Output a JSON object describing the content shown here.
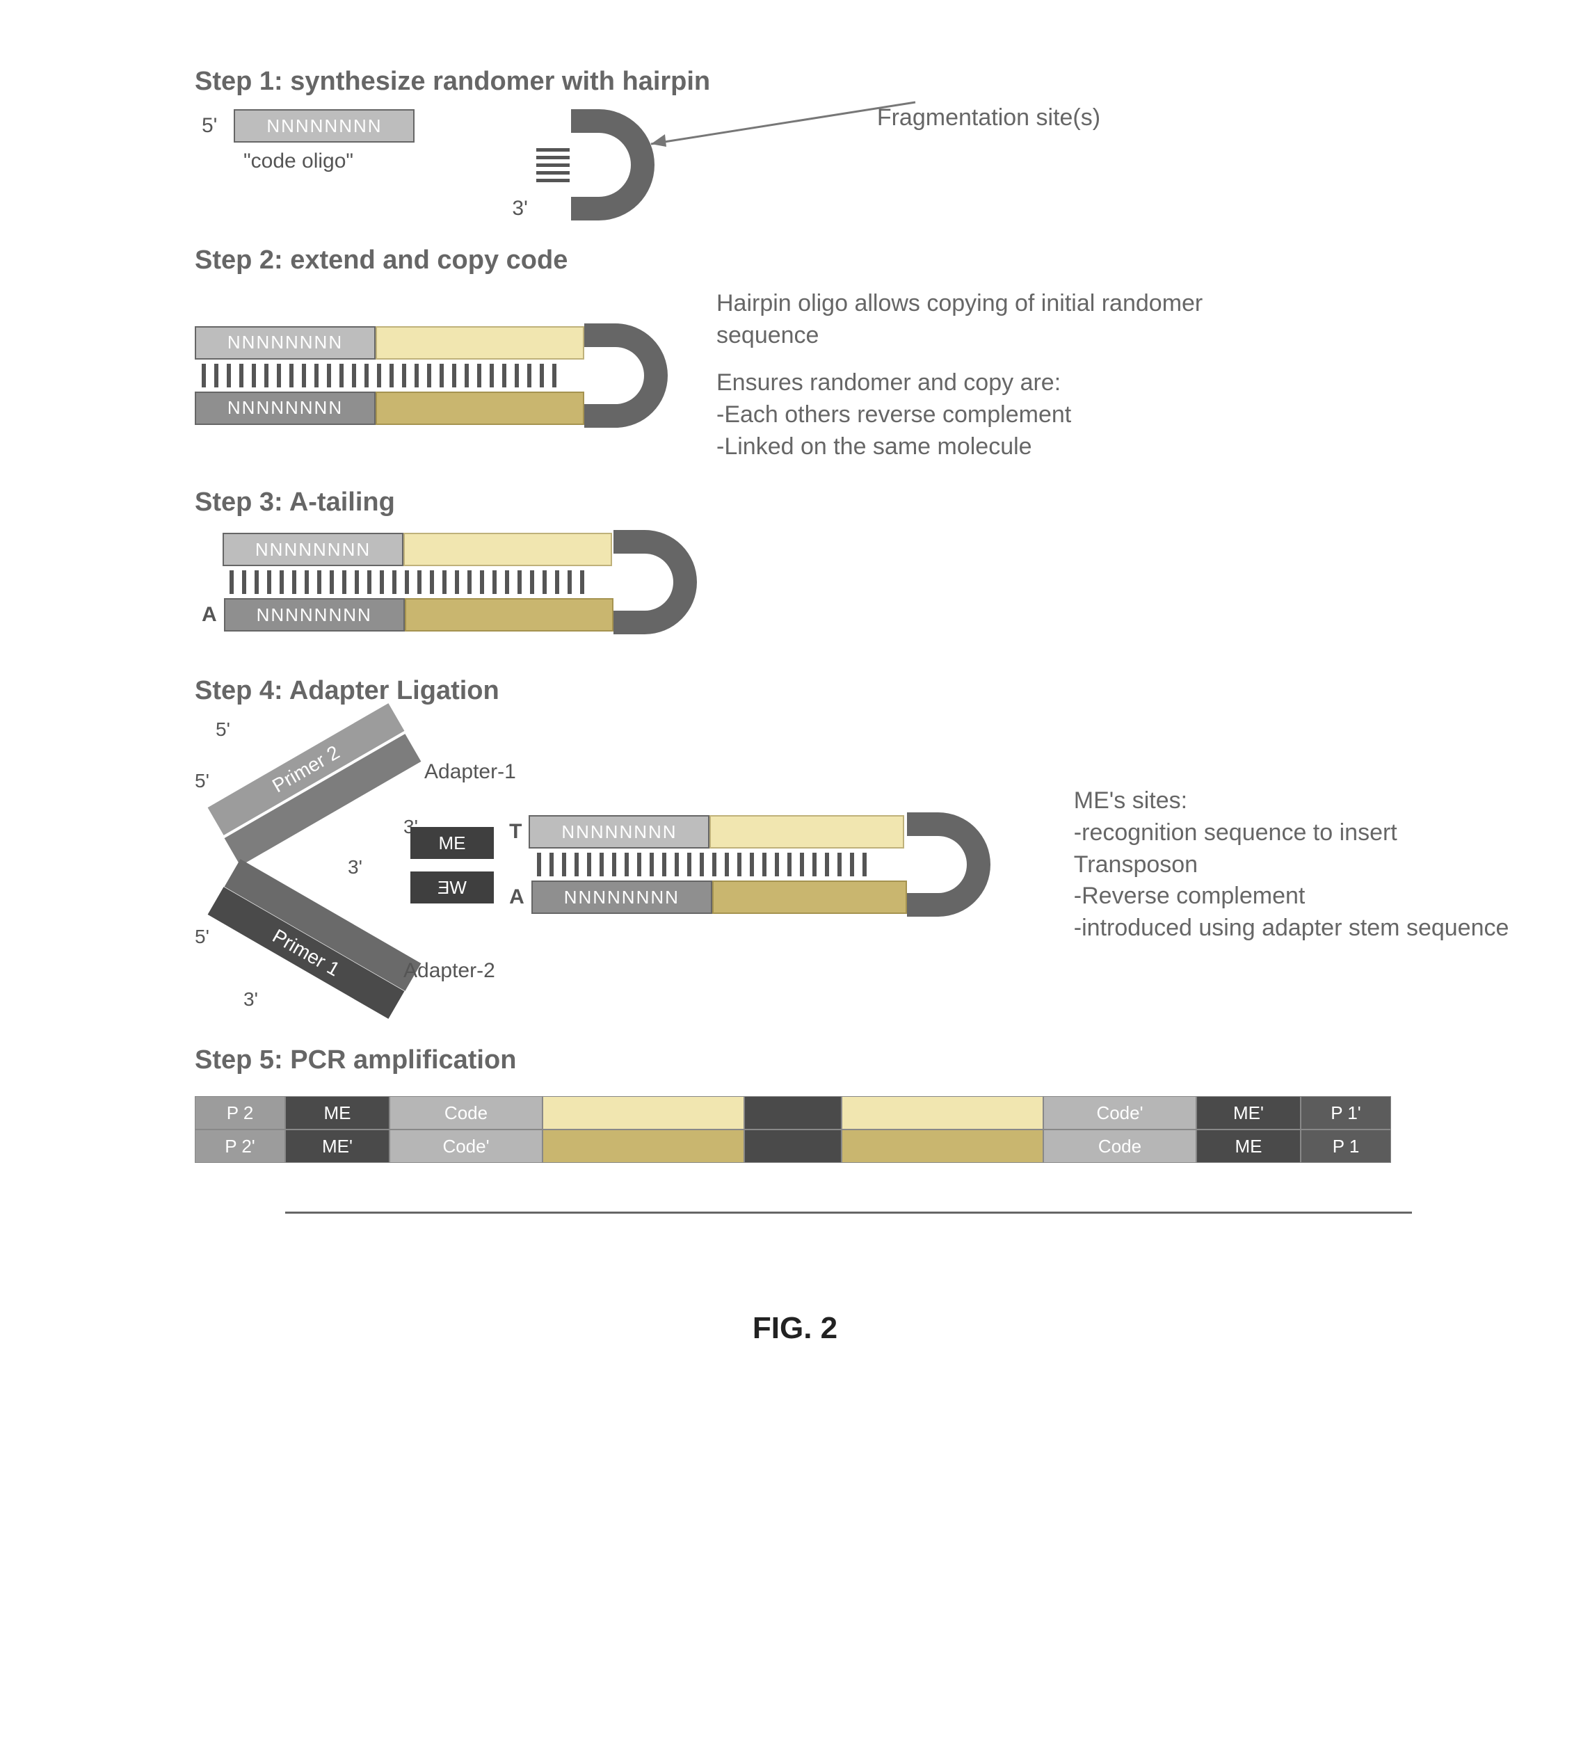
{
  "figure_label": "FIG. 2",
  "step1": {
    "title": "Step 1: synthesize randomer with hairpin",
    "five_prime": "5'",
    "three_prime": "3'",
    "randomer": "NNNNNNNN",
    "code_oligo_label": "\"code oligo\"",
    "arrow_label": "Fragmentation site(s)"
  },
  "step2": {
    "title": "Step 2: extend and copy code",
    "randomer_top": "NNNNNNNN",
    "randomer_bot": "NNNNNNNN",
    "anno_line1": "Hairpin oligo allows copying of initial randomer sequence",
    "anno_line2": "Ensures randomer and copy are:",
    "anno_line3": "-Each others reverse complement",
    "anno_line4": "-Linked on the same molecule"
  },
  "step3": {
    "title": "Step 3: A-tailing",
    "randomer_top": "NNNNNNNN",
    "randomer_bot": "NNNNNNNN",
    "a_label": "A"
  },
  "step4": {
    "title": "Step 4: Adapter Ligation",
    "five_prime": "5'",
    "three_prime": "3'",
    "adapter1_label": "Adapter-1",
    "adapter2_label": "Adapter-2",
    "primer1": "Primer 1",
    "primer2": "Primer 2",
    "me_top": "ME",
    "me_bot": "ƎW",
    "t_label": "T",
    "a_label": "A",
    "randomer_top": "NNNNNNNN",
    "randomer_bot": "NNNNNNNN",
    "anno_title": "ME's sites:",
    "anno_l1": "-recognition sequence to insert Transposon",
    "anno_l2": "-Reverse complement",
    "anno_l3": "-introduced using adapter stem sequence"
  },
  "step5": {
    "title": "Step 5: PCR amplification",
    "top": [
      "P 2",
      "ME",
      "Code",
      "",
      "",
      "",
      "Code'",
      "ME'",
      "P 1'"
    ],
    "bot": [
      "P 2'",
      "ME'",
      "Code'",
      "",
      "",
      "",
      "Code",
      "ME",
      "P 1"
    ]
  }
}
